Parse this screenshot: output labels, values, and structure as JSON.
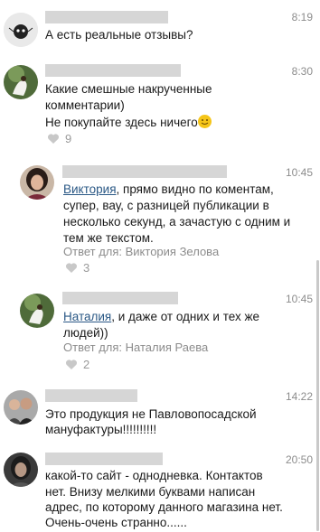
{
  "comments": [
    {
      "time": "8:19",
      "text": "А есть реальные отзывы?"
    },
    {
      "time": "8:30",
      "text_line1": "Какие смешные накрученные",
      "text_line2": "комментарии)",
      "text_line3": "Не покупайте здесь ничего",
      "likes": "9"
    },
    {
      "time": "10:45",
      "mention": "Виктория",
      "text_rest1": ", прямо видно по коментам,",
      "text_line2": "супер, вау, с разницей публикации  в",
      "text_line3": "несколько секунд, а зачастую с одним и",
      "text_line4": "тем же текстом.",
      "reply_to": "Ответ для: Виктория Зелова",
      "likes": "3"
    },
    {
      "time": "10:45",
      "mention": "Наталия",
      "text_rest1": ", и даже от одних и тех же",
      "text_line2": "людей))",
      "reply_to": "Ответ для: Наталия Раева",
      "likes": "2"
    },
    {
      "time": "14:22",
      "text_line1": "Это продукция не Павловопосадской",
      "text_line2": "мануфактуры!!!!!!!!!!"
    },
    {
      "time": "20:50",
      "text_line1": "какой-то сайт - однодневка. Контактов",
      "text_line2": "нет. Внизу мелкими буквами написан",
      "text_line3": "адрес, по которому данного магазина нет.",
      "text_line4": "Очень-очень странно......"
    }
  ],
  "colors": {
    "link": "#2a5885",
    "muted": "#8c8c8c",
    "redaction": "#d6d6d6"
  }
}
